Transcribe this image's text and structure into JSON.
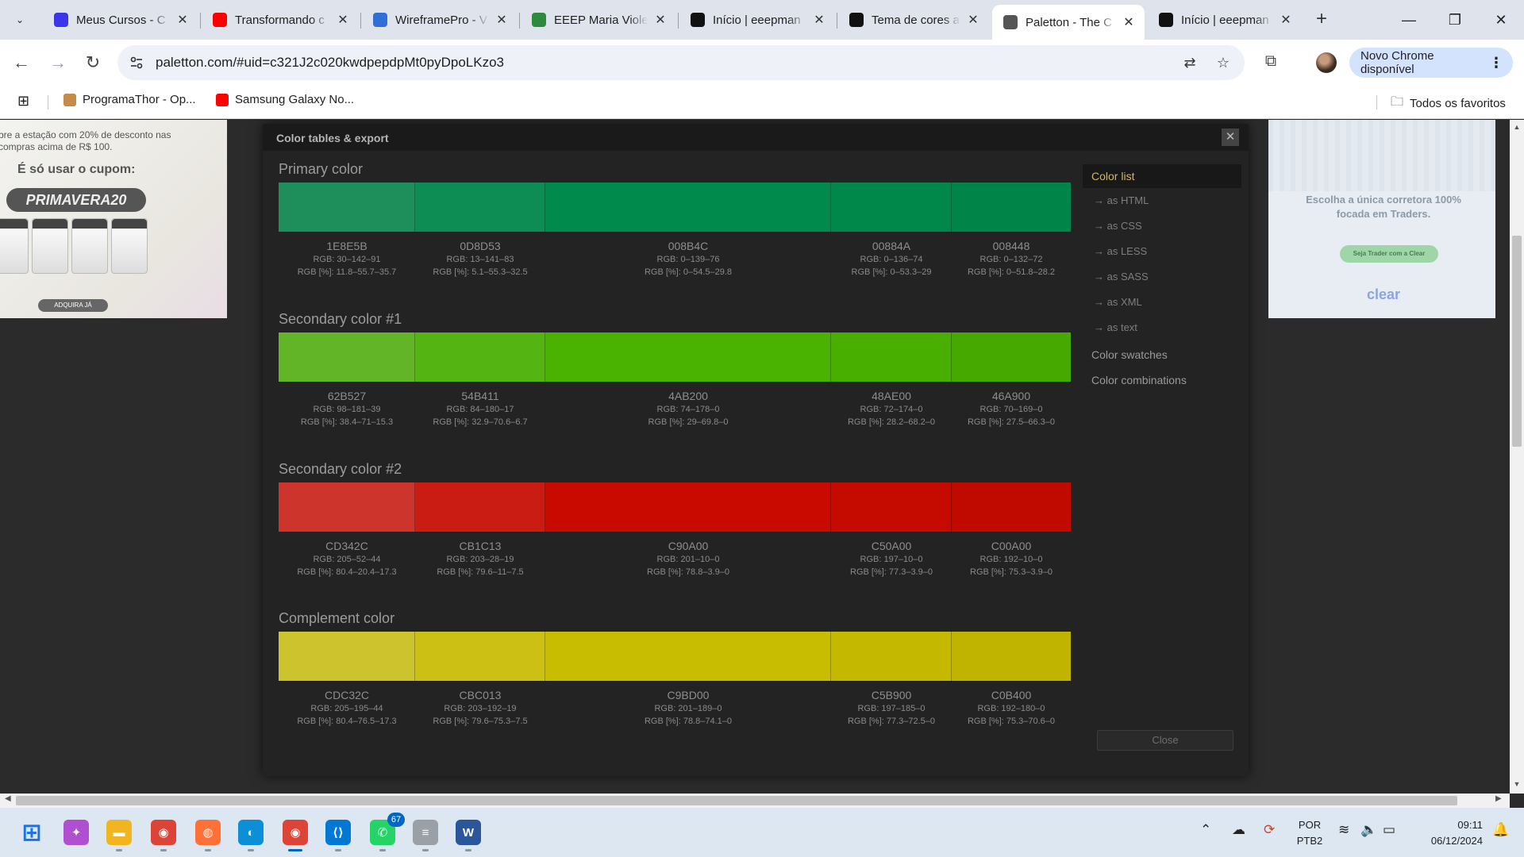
{
  "browser": {
    "tabs": [
      {
        "title": "Meus Cursos - C",
        "favicon": "video-play-icon",
        "color": "#3a37e8",
        "active": false
      },
      {
        "title": "Transformando c",
        "favicon": "youtube-icon",
        "color": "#ff0000",
        "active": false
      },
      {
        "title": "WireframePro - V",
        "favicon": "wireframepro-icon",
        "color": "#2f6fd6",
        "active": false
      },
      {
        "title": "EEEP Maria Viole",
        "favicon": "recycle-icon",
        "color": "#2e8b3d",
        "active": false
      },
      {
        "title": "Início | eeepman",
        "favicon": "wix-icon",
        "color": "#111111",
        "active": false
      },
      {
        "title": "Tema de cores a",
        "favicon": "openai-icon",
        "color": "#111111",
        "active": false
      },
      {
        "title": "Paletton - The C",
        "favicon": "paletton-icon",
        "color": "#555555",
        "active": true
      },
      {
        "title": "Início | eeepman",
        "favicon": "wix-icon",
        "color": "#111111",
        "active": false
      }
    ],
    "url": "paletton.com/#uid=c321J2c020kwdpepdpMt0pyDpoLKzo3",
    "update_label": "Novo Chrome disponível",
    "bookmarks": [
      {
        "label": "ProgramaThor - Op...",
        "icon": "programathor-icon"
      },
      {
        "label": "Samsung Galaxy No...",
        "icon": "youtube-icon"
      }
    ],
    "all_bookmarks_label": "Todos os favoritos"
  },
  "ads": {
    "left": {
      "text1": "bre a estação com 20% de desconto nas compras acima de R$ 100.",
      "text2": "É só usar o cupom:",
      "code": "PRIMAVERA20",
      "cta": "ADQUIRA JÁ"
    },
    "right": {
      "text": "Escolha a única corretora 100% focada em Traders.",
      "button": "Seja Trader com a Clear",
      "logo": "clear"
    }
  },
  "dialog": {
    "title": "Color tables & export",
    "close_x": "✕",
    "groups": [
      {
        "name": "Primary color",
        "swatches": [
          {
            "hex": "1E8E5B",
            "rgb": "RGB: 30–142–91",
            "pct": "RGB [%]: 11.8–55.7–35.7",
            "color": "#1E8E5B"
          },
          {
            "hex": "0D8D53",
            "rgb": "RGB: 13–141–83",
            "pct": "RGB [%]: 5.1–55.3–32.5",
            "color": "#0D8D53"
          },
          {
            "hex": "008B4C",
            "rgb": "RGB: 0–139–76",
            "pct": "RGB [%]: 0–54.5–29.8",
            "color": "#008B4C"
          },
          {
            "hex": "00884A",
            "rgb": "RGB: 0–136–74",
            "pct": "RGB [%]: 0–53.3–29",
            "color": "#00884A"
          },
          {
            "hex": "008448",
            "rgb": "RGB: 0–132–72",
            "pct": "RGB [%]: 0–51.8–28.2",
            "color": "#008448"
          }
        ]
      },
      {
        "name": "Secondary color #1",
        "swatches": [
          {
            "hex": "62B527",
            "rgb": "RGB: 98–181–39",
            "pct": "RGB [%]: 38.4–71–15.3",
            "color": "#62B527"
          },
          {
            "hex": "54B411",
            "rgb": "RGB: 84–180–17",
            "pct": "RGB [%]: 32.9–70.6–6.7",
            "color": "#54B411"
          },
          {
            "hex": "4AB200",
            "rgb": "RGB: 74–178–0",
            "pct": "RGB [%]: 29–69.8–0",
            "color": "#4AB200"
          },
          {
            "hex": "48AE00",
            "rgb": "RGB: 72–174–0",
            "pct": "RGB [%]: 28.2–68.2–0",
            "color": "#48AE00"
          },
          {
            "hex": "46A900",
            "rgb": "RGB: 70–169–0",
            "pct": "RGB [%]: 27.5–66.3–0",
            "color": "#46A900"
          }
        ]
      },
      {
        "name": "Secondary color #2",
        "swatches": [
          {
            "hex": "CD342C",
            "rgb": "RGB: 205–52–44",
            "pct": "RGB [%]: 80.4–20.4–17.3",
            "color": "#CD342C"
          },
          {
            "hex": "CB1C13",
            "rgb": "RGB: 203–28–19",
            "pct": "RGB [%]: 79.6–11–7.5",
            "color": "#CB1C13"
          },
          {
            "hex": "C90A00",
            "rgb": "RGB: 201–10–0",
            "pct": "RGB [%]: 78.8–3.9–0",
            "color": "#C90A00"
          },
          {
            "hex": "C50A00",
            "rgb": "RGB: 197–10–0",
            "pct": "RGB [%]: 77.3–3.9–0",
            "color": "#C50A00"
          },
          {
            "hex": "C00A00",
            "rgb": "RGB: 192–10–0",
            "pct": "RGB [%]: 75.3–3.9–0",
            "color": "#C00A00"
          }
        ]
      },
      {
        "name": "Complement color",
        "swatches": [
          {
            "hex": "CDC32C",
            "rgb": "RGB: 205–195–44",
            "pct": "RGB [%]: 80.4–76.5–17.3",
            "color": "#CDC32C"
          },
          {
            "hex": "CBC013",
            "rgb": "RGB: 203–192–19",
            "pct": "RGB [%]: 79.6–75.3–7.5",
            "color": "#CBC013"
          },
          {
            "hex": "C9BD00",
            "rgb": "RGB: 201–189–0",
            "pct": "RGB [%]: 78.8–74.1–0",
            "color": "#C9BD00"
          },
          {
            "hex": "C5B900",
            "rgb": "RGB: 197–185–0",
            "pct": "RGB [%]: 77.3–72.5–0",
            "color": "#C5B900"
          },
          {
            "hex": "C0B400",
            "rgb": "RGB: 192–180–0",
            "pct": "RGB [%]: 75.3–70.6–0",
            "color": "#C0B400"
          }
        ]
      }
    ],
    "menu": {
      "active": "Color list",
      "sub_items": [
        "→ as HTML",
        "→ as CSS",
        "→ as LESS",
        "→ as SASS",
        "→ as XML",
        "→ as text"
      ],
      "items": [
        "Color swatches",
        "Color combinations"
      ]
    },
    "close_label": "Close"
  },
  "taskbar": {
    "apps": [
      {
        "name": "windows-start-icon",
        "color": "#1a73e8"
      },
      {
        "name": "copilot-icon",
        "color": "#b04fd0"
      },
      {
        "name": "file-explorer-icon",
        "color": "#f2b522"
      },
      {
        "name": "chrome-icon",
        "color": "#db4437"
      },
      {
        "name": "firefox-icon",
        "color": "#ff7139"
      },
      {
        "name": "edge-icon",
        "color": "#0c8fd6"
      },
      {
        "name": "chrome-profile-icon",
        "color": "#db4437"
      },
      {
        "name": "vscode-icon",
        "color": "#0078d4"
      },
      {
        "name": "whatsapp-icon",
        "color": "#25d366"
      },
      {
        "name": "app-icon",
        "color": "#9aa0a6"
      },
      {
        "name": "word-icon",
        "color": "#2b579a"
      }
    ],
    "whatsapp_badge": "67",
    "lang_top": "POR",
    "lang_bottom": "PTB2",
    "time": "09:11",
    "date": "06/12/2024"
  }
}
